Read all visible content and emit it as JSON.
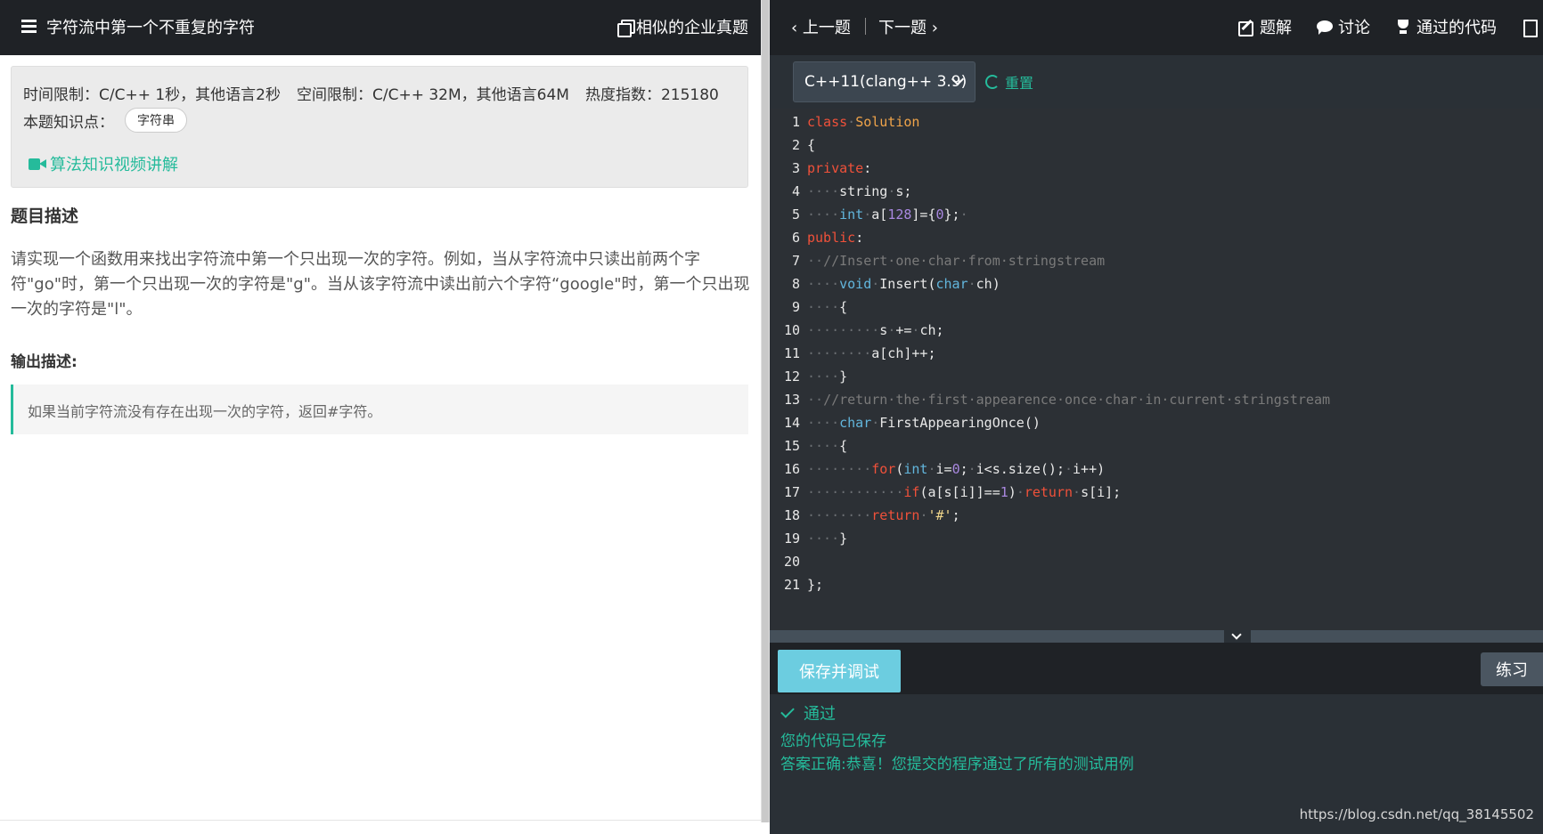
{
  "problem": {
    "title": "字符流中第一个不重复的字符",
    "similar_label": "相似的企业真题",
    "time_limit": "时间限制：C/C++ 1秒，其他语言2秒",
    "space_limit": "空间限制：C/C++ 32M，其他语言64M",
    "heat": "热度指数：215180",
    "knowledge_label": "本题知识点：",
    "knowledge_tag": "字符串",
    "video_link": "算法知识视频讲解",
    "desc_title": "题目描述",
    "description": "请实现一个函数用来找出字符流中第一个只出现一次的字符。例如，当从字符流中只读出前两个字符\"go\"时，第一个只出现一次的字符是\"g\"。当从该字符流中读出前六个字符“google\"时，第一个只出现一次的字符是\"l\"。",
    "output_title": "输出描述:",
    "output_desc": "如果当前字符流没有存在出现一次的字符，返回#字符。"
  },
  "nav": {
    "prev": "上一题",
    "next": "下一题",
    "tools": [
      {
        "label": "题解",
        "icon": "edit-icon"
      },
      {
        "label": "讨论",
        "icon": "chat-icon"
      },
      {
        "label": "通过的代码",
        "icon": "trophy-icon"
      },
      {
        "label": "",
        "icon": "doc-icon"
      }
    ]
  },
  "editor": {
    "language": "C++11(clang++ 3.9)",
    "reset_label": "重置",
    "lines": [
      [
        [
          "kw",
          "class"
        ],
        [
          "ws",
          "·"
        ],
        [
          "cls",
          "Solution"
        ]
      ],
      [
        [
          "pl",
          "{"
        ]
      ],
      [
        [
          "kw",
          "private"
        ],
        [
          "pl",
          ":"
        ]
      ],
      [
        [
          "ws",
          "····"
        ],
        [
          "pl",
          "string"
        ],
        [
          "ws",
          "·"
        ],
        [
          "pl",
          "s;"
        ]
      ],
      [
        [
          "ws",
          "····"
        ],
        [
          "ty",
          "int"
        ],
        [
          "ws",
          "·"
        ],
        [
          "pl",
          "a["
        ],
        [
          "num",
          "128"
        ],
        [
          "pl",
          "]={"
        ],
        [
          "num",
          "0"
        ],
        [
          "pl",
          "};"
        ],
        [
          "ws",
          "·"
        ]
      ],
      [
        [
          "kw",
          "public"
        ],
        [
          "pl",
          ":"
        ]
      ],
      [
        [
          "ws",
          "··"
        ],
        [
          "cm",
          "//Insert·one·char·from·stringstream"
        ]
      ],
      [
        [
          "ws",
          "····"
        ],
        [
          "ty",
          "void"
        ],
        [
          "ws",
          "·"
        ],
        [
          "pl",
          "Insert("
        ],
        [
          "ty",
          "char"
        ],
        [
          "ws",
          "·"
        ],
        [
          "pl",
          "ch)"
        ]
      ],
      [
        [
          "ws",
          "····"
        ],
        [
          "pl",
          "{"
        ]
      ],
      [
        [
          "ws",
          "·········"
        ],
        [
          "pl",
          "s"
        ],
        [
          "ws",
          "·"
        ],
        [
          "pl",
          "+="
        ],
        [
          "ws",
          "·"
        ],
        [
          "pl",
          "ch;"
        ]
      ],
      [
        [
          "ws",
          "········"
        ],
        [
          "pl",
          "a[ch]++;"
        ]
      ],
      [
        [
          "ws",
          "····"
        ],
        [
          "pl",
          "}"
        ]
      ],
      [
        [
          "ws",
          "··"
        ],
        [
          "cm",
          "//return·the·first·appearence·once·char·in·current·stringstream"
        ]
      ],
      [
        [
          "ws",
          "····"
        ],
        [
          "ty",
          "char"
        ],
        [
          "ws",
          "·"
        ],
        [
          "pl",
          "FirstAppearingOnce()"
        ]
      ],
      [
        [
          "ws",
          "····"
        ],
        [
          "pl",
          "{"
        ]
      ],
      [
        [
          "ws",
          "········"
        ],
        [
          "kw",
          "for"
        ],
        [
          "pl",
          "("
        ],
        [
          "ty",
          "int"
        ],
        [
          "ws",
          "·"
        ],
        [
          "pl",
          "i="
        ],
        [
          "num",
          "0"
        ],
        [
          "pl",
          ";"
        ],
        [
          "ws",
          "·"
        ],
        [
          "pl",
          "i<s.size();"
        ],
        [
          "ws",
          "·"
        ],
        [
          "pl",
          "i++)"
        ]
      ],
      [
        [
          "ws",
          "············"
        ],
        [
          "kw",
          "if"
        ],
        [
          "pl",
          "(a[s[i]]=="
        ],
        [
          "num",
          "1"
        ],
        [
          "pl",
          ")"
        ],
        [
          "ws",
          "·"
        ],
        [
          "kw",
          "return"
        ],
        [
          "ws",
          "·"
        ],
        [
          "pl",
          "s[i];"
        ]
      ],
      [
        [
          "ws",
          "········"
        ],
        [
          "kw",
          "return"
        ],
        [
          "ws",
          "·"
        ],
        [
          "str",
          "'#'"
        ],
        [
          "pl",
          ";"
        ]
      ],
      [
        [
          "ws",
          "····"
        ],
        [
          "pl",
          "}"
        ]
      ],
      [],
      [
        [
          "pl",
          "};"
        ]
      ]
    ]
  },
  "actions": {
    "save_debug": "保存并调试",
    "practice": "练习"
  },
  "result": {
    "status": "通过",
    "saved": "您的代码已保存",
    "correct": "答案正确:恭喜！您提交的程序通过了所有的测试用例"
  },
  "watermark": "https://blog.csdn.net/qq_38145502",
  "colors": {
    "accent": "#25bb9b",
    "header_bg": "#1f2226",
    "editor_bg": "#2c3035",
    "save_button": "#6ccde0"
  }
}
